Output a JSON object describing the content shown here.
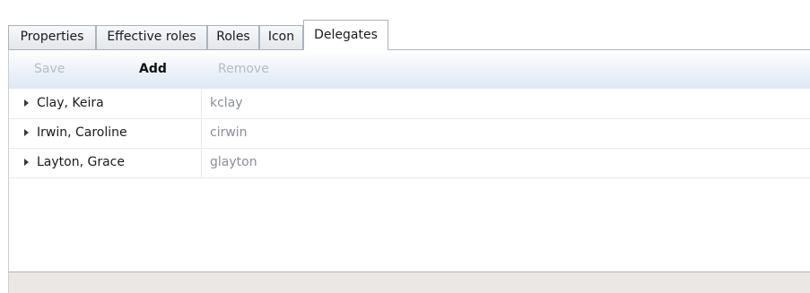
{
  "tabs": [
    {
      "label": "Properties",
      "active": false
    },
    {
      "label": "Effective roles",
      "active": false
    },
    {
      "label": "Roles",
      "active": false
    },
    {
      "label": "Icon",
      "active": false
    },
    {
      "label": "Delegates",
      "active": true
    }
  ],
  "toolbar": {
    "save_label": "Save",
    "add_label": "Add",
    "remove_label": "Remove",
    "save_enabled": false,
    "add_enabled": true,
    "remove_enabled": false
  },
  "delegates": [
    {
      "name": "Clay, Keira",
      "login": "kclay"
    },
    {
      "name": "Irwin, Caroline",
      "login": "cirwin"
    },
    {
      "name": "Layton, Grace",
      "login": "glayton"
    }
  ],
  "colors": {
    "toolbar_gradient_end": "#dde8f4",
    "disabled_text": "#b6bcc4",
    "secondary_text": "#8a8f96",
    "footer_bg": "#ebe7e4"
  }
}
